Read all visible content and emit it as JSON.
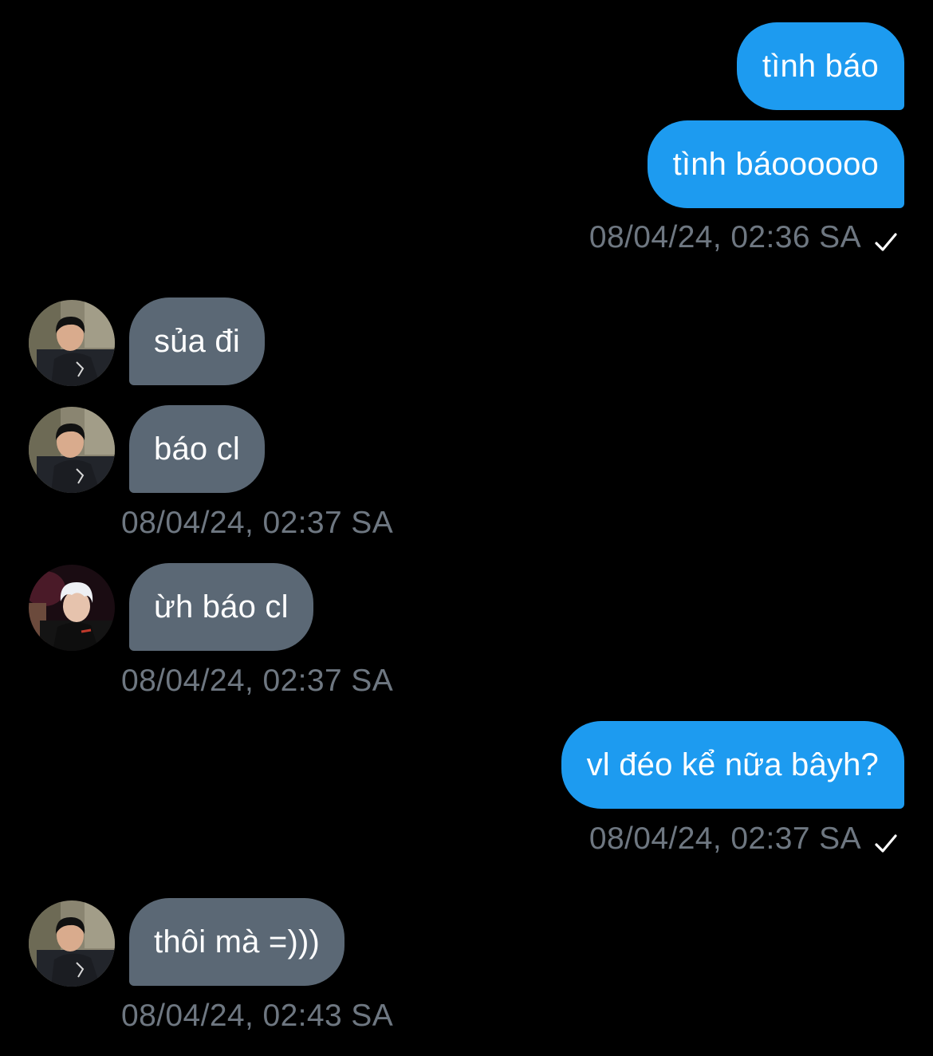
{
  "messages": [
    {
      "sender": "me",
      "text": "tình báo"
    },
    {
      "sender": "me",
      "text": "tình báoooooo"
    },
    {
      "sender": "me",
      "timestamp": "08/04/24, 02:36 SA"
    },
    {
      "sender": "other",
      "text": "sủa đi"
    },
    {
      "sender": "other",
      "text": "báo cl"
    },
    {
      "sender": "other",
      "timestamp": "08/04/24, 02:37 SA"
    },
    {
      "sender": "other",
      "text": "ừh báo cl"
    },
    {
      "sender": "other",
      "timestamp": "08/04/24, 02:37 SA"
    },
    {
      "sender": "me",
      "text": "vl đéo kể nữa bâyh?"
    },
    {
      "sender": "me",
      "timestamp": "08/04/24, 02:37 SA"
    },
    {
      "sender": "other",
      "text": "thôi mà =)))"
    },
    {
      "sender": "other",
      "timestamp": "08/04/24, 02:43 SA"
    }
  ],
  "icons": {
    "read_receipt": "checkmark-icon",
    "avatar": "user-avatar-icon"
  },
  "colors": {
    "background": "#000000",
    "outgoing_bubble": "#1d9bf0",
    "incoming_bubble": "#5b6875",
    "timestamp": "#6e7781",
    "text": "#ffffff"
  }
}
